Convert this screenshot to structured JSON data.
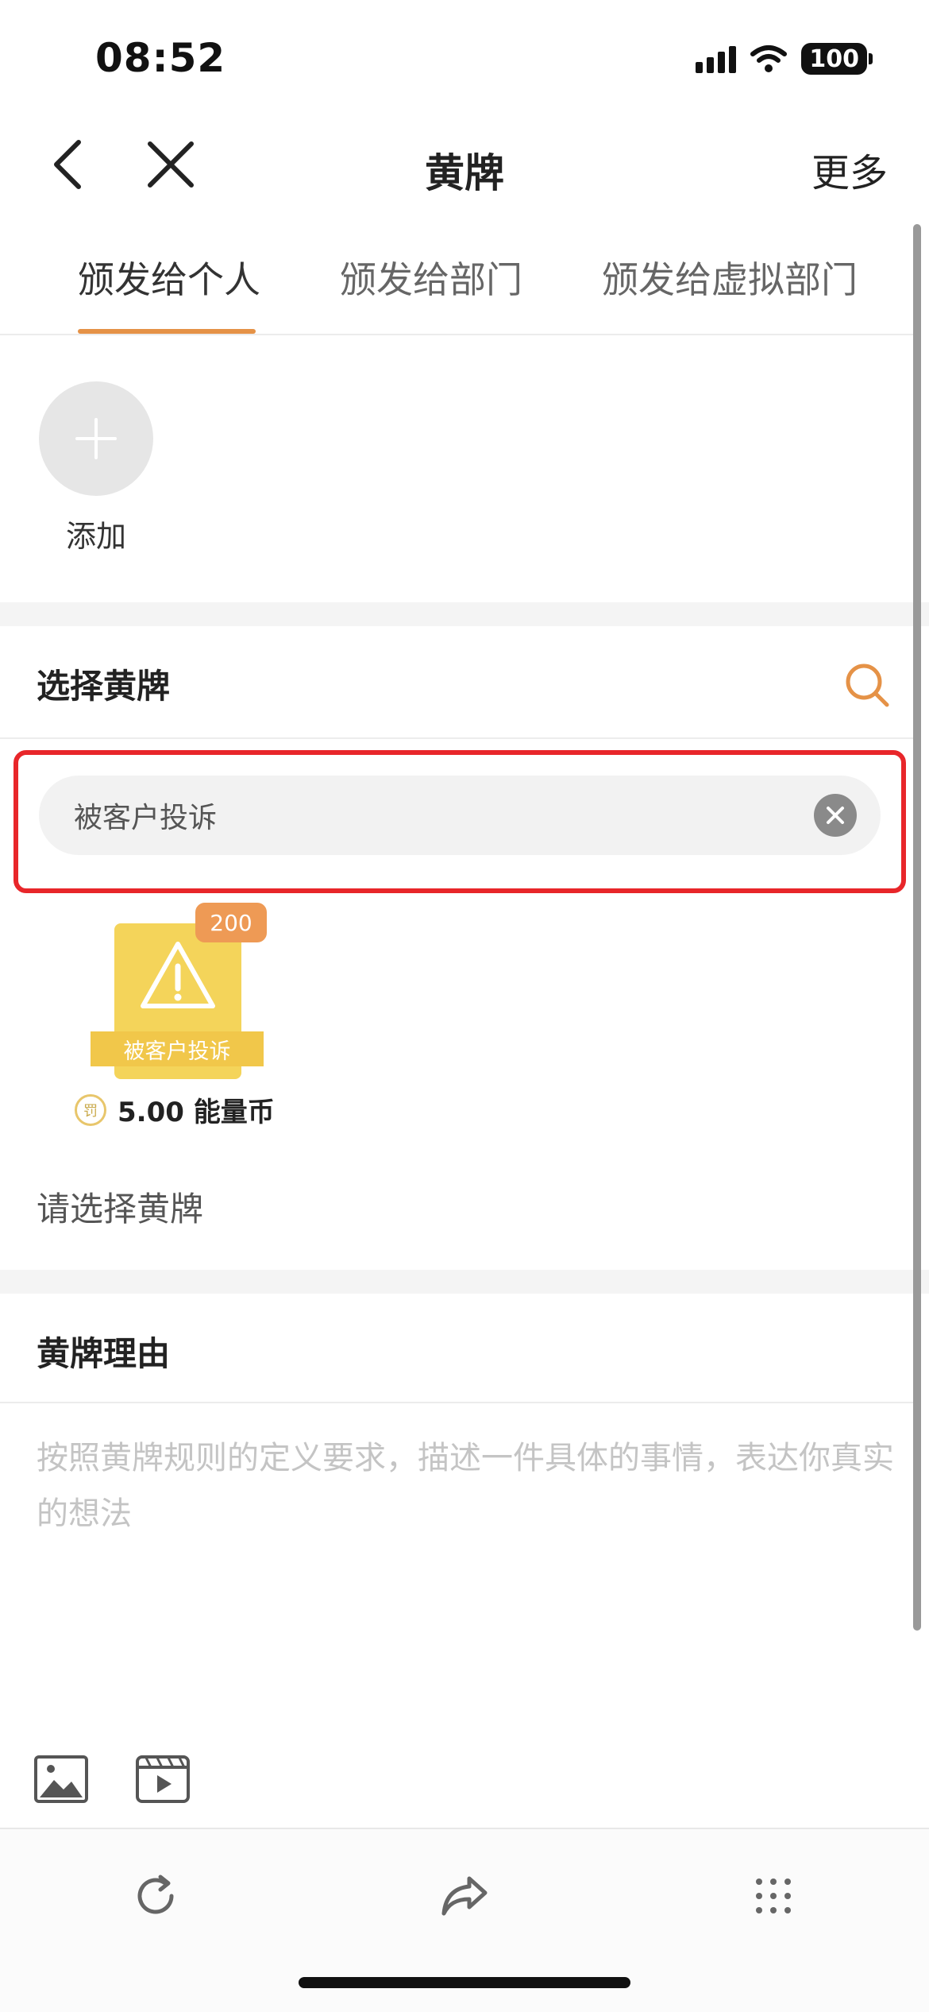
{
  "status_bar": {
    "time": "08:52",
    "battery": "100"
  },
  "nav": {
    "title": "黄牌",
    "more": "更多"
  },
  "tabs": [
    {
      "label": "颁发给个人",
      "active": true
    },
    {
      "label": "颁发给部门",
      "active": false
    },
    {
      "label": "颁发给虚拟部门",
      "active": false
    }
  ],
  "add": {
    "label": "添加"
  },
  "select_section": {
    "title": "选择黄牌",
    "search_value": "被客户投诉",
    "badge": {
      "count": "200",
      "name": "被客户投诉",
      "coin_glyph": "罚",
      "price": "5.00 能量币"
    },
    "hint": "请选择黄牌"
  },
  "reason_section": {
    "title": "黄牌理由",
    "placeholder": "按照黄牌规则的定义要求，描述一件具体的事情，表达你真实的想法"
  },
  "colors": {
    "accent": "#e59247",
    "badge_yellow": "#f4d45a",
    "highlight_border": "#e8262a",
    "count_badge": "#ee9a55"
  },
  "icons": {
    "nav": [
      "back-icon",
      "close-icon"
    ],
    "media": [
      "image-icon",
      "video-icon"
    ],
    "toolbar": [
      "refresh-icon",
      "share-icon",
      "more-dots-icon"
    ]
  }
}
